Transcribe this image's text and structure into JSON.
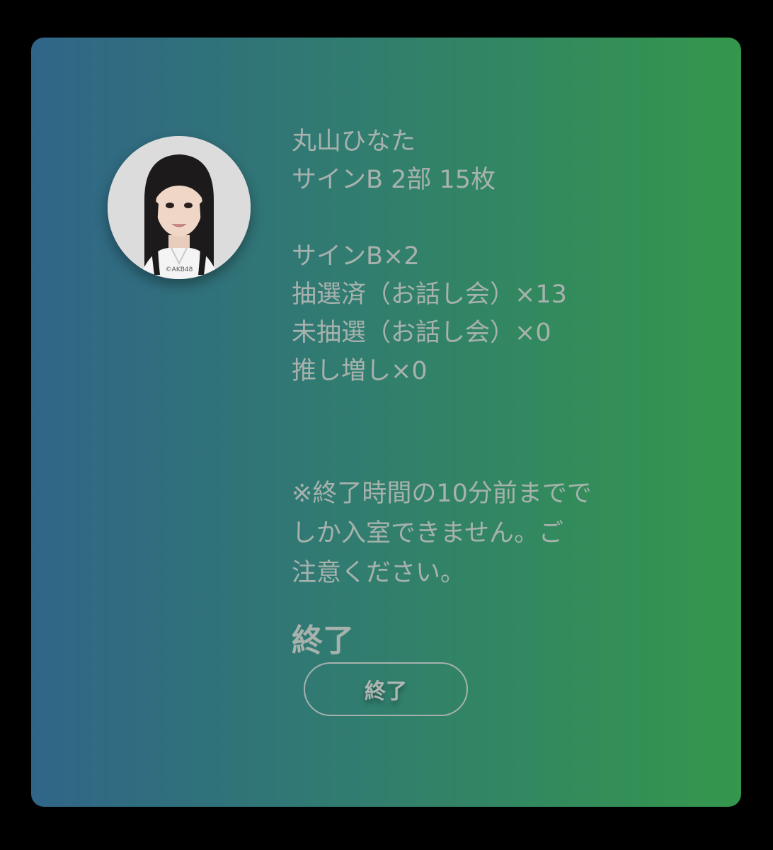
{
  "member": {
    "name": "丸山ひなた",
    "session": "サインB 2部 15枚",
    "photo_watermark": "©AKB48"
  },
  "tickets": [
    "サインB×2",
    "抽選済（お話し会）×13",
    "未抽選（お話し会）×0",
    "推し増し×0"
  ],
  "notice": [
    "※終了時間の10分前までで",
    "しか入室できません。ご",
    "注意ください。"
  ],
  "status_label": "終了",
  "end_button_label": "終了",
  "colors": {
    "gradient_left": "#306588",
    "gradient_right": "#34974c",
    "text": "#a7b2ad",
    "background": "#000000"
  }
}
